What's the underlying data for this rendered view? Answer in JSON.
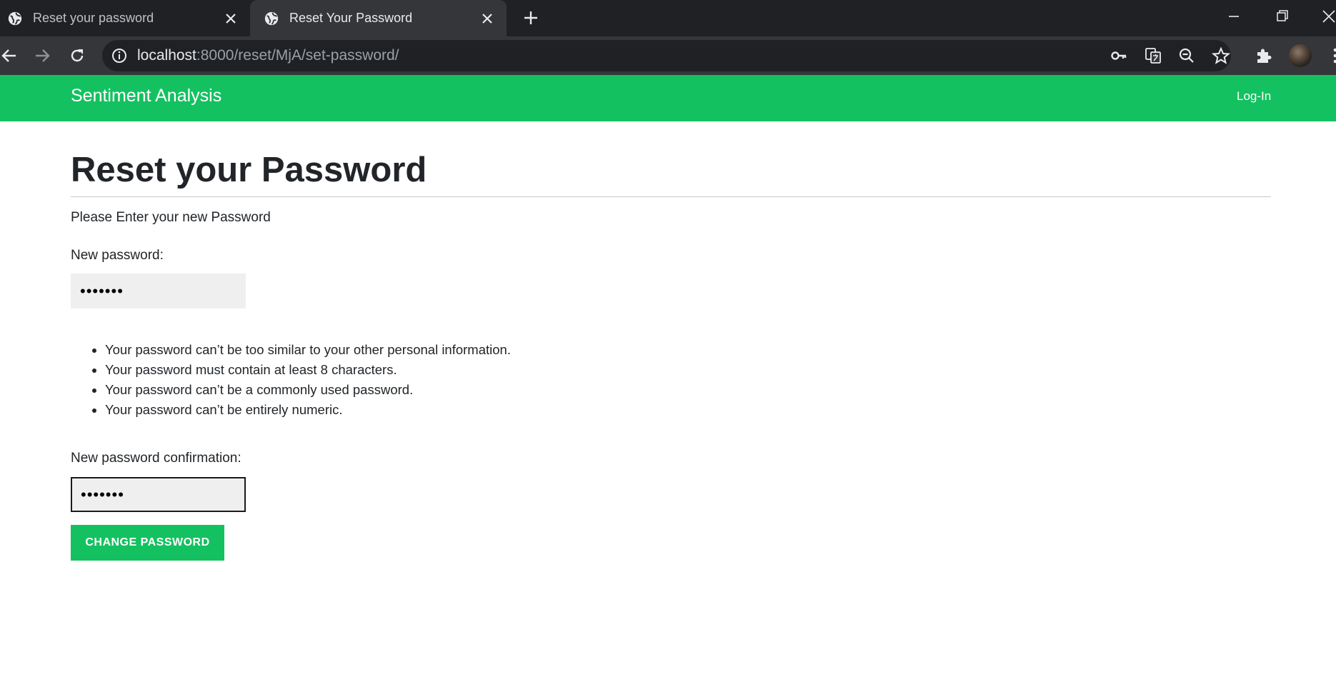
{
  "browser": {
    "tabs": [
      {
        "title": "Reset your password",
        "active": false
      },
      {
        "title": "Reset Your Password",
        "active": true
      }
    ],
    "url_host": "localhost",
    "url_path": ":8000/reset/MjA/set-password/",
    "toolbar_icons": [
      "back-icon",
      "forward-icon",
      "reload-icon",
      "info-icon",
      "key-icon",
      "translate-icon",
      "zoom-out-icon",
      "star-icon",
      "extensions-icon",
      "profile-avatar",
      "menu-icon"
    ]
  },
  "navbar": {
    "brand": "Sentiment Analysis",
    "login_label": "Log-In",
    "color": "#14c160"
  },
  "main": {
    "title": "Reset your Password",
    "intro": "Please Enter your new Password",
    "new_password_label": "New password:",
    "new_password_value": "•••••••",
    "rules": [
      "Your password can’t be too similar to your other personal information.",
      "Your password must contain at least 8 characters.",
      "Your password can’t be a commonly used password.",
      "Your password can’t be entirely numeric."
    ],
    "confirm_label": "New password confirmation:",
    "confirm_value": "•••••••",
    "submit_label": "CHANGE PASSWORD"
  }
}
